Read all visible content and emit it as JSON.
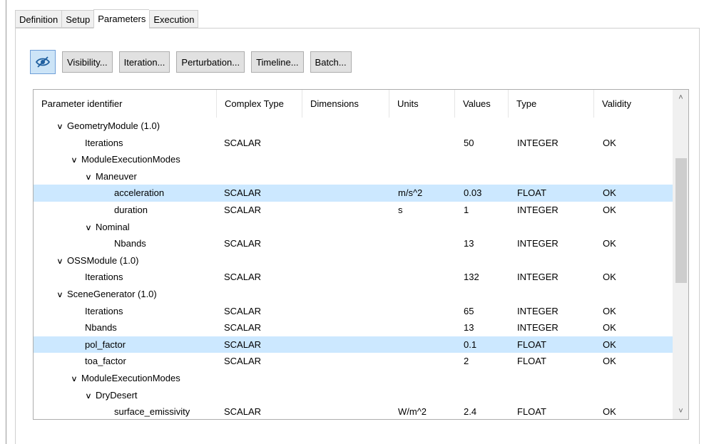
{
  "tabs": [
    "Definition",
    "Setup",
    "Parameters",
    "Execution"
  ],
  "toolbar": {
    "toggle_icon": "eye-slash-icon",
    "buttons": [
      "Visibility...",
      "Iteration...",
      "Perturbation...",
      "Timeline...",
      "Batch..."
    ]
  },
  "table": {
    "headers": [
      "Parameter identifier",
      "Complex Type",
      "Dimensions",
      "Units",
      "Values",
      "Type",
      "Validity"
    ],
    "rows": [
      {
        "indent": 1,
        "expander": true,
        "name": "GeometryModule (1.0)",
        "complex": "",
        "dims": "",
        "units": "",
        "value": "",
        "type": "",
        "validity": "",
        "selected": false
      },
      {
        "indent": 2,
        "expander": false,
        "name": "Iterations",
        "complex": "SCALAR",
        "dims": "",
        "units": "",
        "value": "50",
        "type": "INTEGER",
        "validity": "OK",
        "selected": false
      },
      {
        "indent": 2,
        "expander": true,
        "name": "ModuleExecutionModes",
        "complex": "",
        "dims": "",
        "units": "",
        "value": "",
        "type": "",
        "validity": "",
        "selected": false
      },
      {
        "indent": 3,
        "expander": true,
        "name": "Maneuver",
        "complex": "",
        "dims": "",
        "units": "",
        "value": "",
        "type": "",
        "validity": "",
        "selected": false
      },
      {
        "indent": 4,
        "expander": false,
        "name": "acceleration",
        "complex": "SCALAR",
        "dims": "",
        "units": "m/s^2",
        "value": "0.03",
        "type": "FLOAT",
        "validity": "OK",
        "selected": true
      },
      {
        "indent": 4,
        "expander": false,
        "name": "duration",
        "complex": "SCALAR",
        "dims": "",
        "units": "s",
        "value": "1",
        "type": "INTEGER",
        "validity": "OK",
        "selected": false
      },
      {
        "indent": 3,
        "expander": true,
        "name": "Nominal",
        "complex": "",
        "dims": "",
        "units": "",
        "value": "",
        "type": "",
        "validity": "",
        "selected": false
      },
      {
        "indent": 4,
        "expander": false,
        "name": "Nbands",
        "complex": "SCALAR",
        "dims": "",
        "units": "",
        "value": "13",
        "type": "INTEGER",
        "validity": "OK",
        "selected": false
      },
      {
        "indent": 1,
        "expander": true,
        "name": "OSSModule (1.0)",
        "complex": "",
        "dims": "",
        "units": "",
        "value": "",
        "type": "",
        "validity": "",
        "selected": false
      },
      {
        "indent": 2,
        "expander": false,
        "name": "Iterations",
        "complex": "SCALAR",
        "dims": "",
        "units": "",
        "value": "132",
        "type": "INTEGER",
        "validity": "OK",
        "selected": false
      },
      {
        "indent": 1,
        "expander": true,
        "name": "SceneGenerator (1.0)",
        "complex": "",
        "dims": "",
        "units": "",
        "value": "",
        "type": "",
        "validity": "",
        "selected": false
      },
      {
        "indent": 2,
        "expander": false,
        "name": "Iterations",
        "complex": "SCALAR",
        "dims": "",
        "units": "",
        "value": "65",
        "type": "INTEGER",
        "validity": "OK",
        "selected": false
      },
      {
        "indent": 2,
        "expander": false,
        "name": "Nbands",
        "complex": "SCALAR",
        "dims": "",
        "units": "",
        "value": "13",
        "type": "INTEGER",
        "validity": "OK",
        "selected": false
      },
      {
        "indent": 2,
        "expander": false,
        "name": "pol_factor",
        "complex": "SCALAR",
        "dims": "",
        "units": "",
        "value": "0.1",
        "type": "FLOAT",
        "validity": "OK",
        "selected": true
      },
      {
        "indent": 2,
        "expander": false,
        "name": "toa_factor",
        "complex": "SCALAR",
        "dims": "",
        "units": "",
        "value": "2",
        "type": "FLOAT",
        "validity": "OK",
        "selected": false
      },
      {
        "indent": 2,
        "expander": true,
        "name": "ModuleExecutionModes",
        "complex": "",
        "dims": "",
        "units": "",
        "value": "",
        "type": "",
        "validity": "",
        "selected": false
      },
      {
        "indent": 3,
        "expander": true,
        "name": "DryDesert",
        "complex": "",
        "dims": "",
        "units": "",
        "value": "",
        "type": "",
        "validity": "",
        "selected": false
      },
      {
        "indent": 4,
        "expander": false,
        "name": "surface_emissivity",
        "complex": "SCALAR",
        "dims": "",
        "units": "W/m^2",
        "value": "2.4",
        "type": "FLOAT",
        "validity": "OK",
        "selected": false
      }
    ]
  },
  "scrollbar": {
    "up_icon": "chevron-up-icon",
    "down_icon": "chevron-down-icon"
  },
  "colors": {
    "selection": "#cce8ff",
    "toggle_button": "#cce4f7"
  }
}
